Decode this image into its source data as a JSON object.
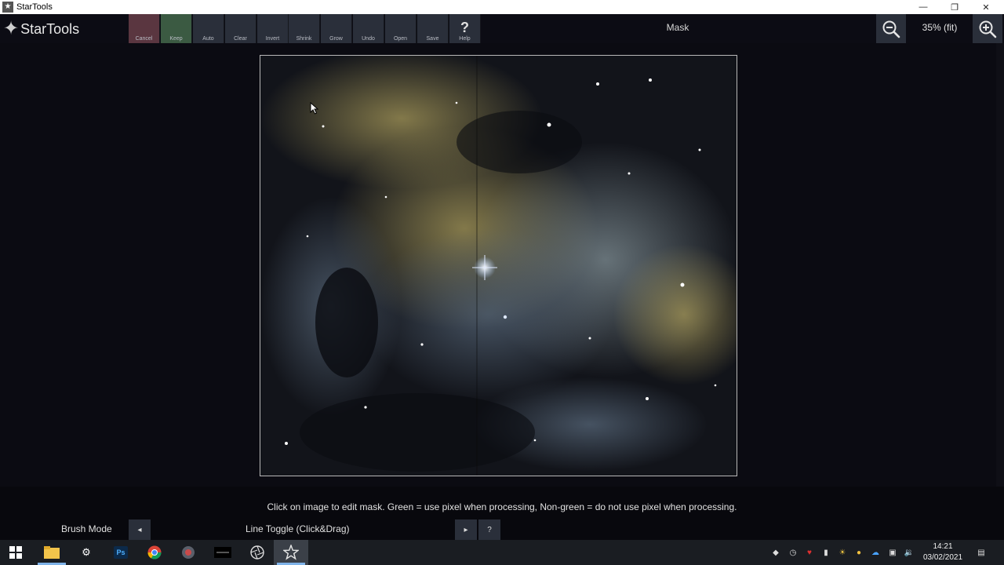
{
  "window": {
    "title": "StarTools",
    "controls": {
      "minimize": "—",
      "restore": "❐",
      "close": "✕"
    }
  },
  "app": {
    "logo_text": "StarTools",
    "module_title": "Mask",
    "zoom_level": "35% (fit)",
    "toolbar": [
      {
        "label": "Cancel",
        "icon": "cancel"
      },
      {
        "label": "Keep",
        "icon": "keep"
      },
      {
        "label": "Auto",
        "icon": "auto"
      },
      {
        "label": "Clear",
        "icon": "clear"
      },
      {
        "label": "Invert",
        "icon": "invert"
      },
      {
        "label": "Shrink",
        "icon": "shrink"
      },
      {
        "label": "Grow",
        "icon": "grow"
      },
      {
        "label": "Undo",
        "icon": "undo"
      },
      {
        "label": "Open",
        "icon": "open"
      },
      {
        "label": "Save",
        "icon": "save"
      },
      {
        "label": "Help",
        "icon": "question-mark",
        "glyph": "?"
      }
    ]
  },
  "canvas": {
    "image_description_icon": "nebula-image"
  },
  "bottom": {
    "hint": "Click on image to edit mask. Green = use pixel when processing, Non-green = do not use pixel when processing.",
    "brush_mode_label": "Brush Mode",
    "brush_mode_value": "Line Toggle (Click&Drag)",
    "prev_glyph": "◂",
    "next_glyph": "▸",
    "help_glyph": "?"
  },
  "taskbar": {
    "clock_time": "14:21",
    "clock_date": "03/02/2021",
    "pinned": [
      "windows-start-icon",
      "file-explorer-icon",
      "settings-gear-icon",
      "photoshop-icon",
      "chrome-icon",
      "app-icon",
      "app-icon",
      "app-icon",
      "startools-icon"
    ],
    "photoshop_label": "Ps"
  },
  "colors": {
    "cancel": "#5a3640",
    "keep": "#3b5a42",
    "toolbar_button": "#2a2f3a",
    "background": "#0b0b12"
  }
}
